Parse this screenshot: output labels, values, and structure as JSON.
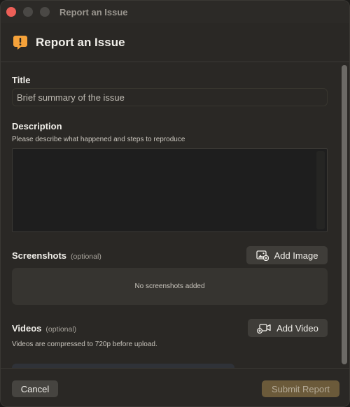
{
  "window": {
    "title": "Report an Issue",
    "traffic_colors": {
      "close": "#ec5f57",
      "minimize": "#4a4845",
      "maximize": "#4a4845"
    }
  },
  "header": {
    "icon": "exclamation-bubble-icon",
    "icon_color": "#f5a23a",
    "title": "Report an Issue"
  },
  "form": {
    "title_label": "Title",
    "title_placeholder": "Brief summary of the issue",
    "title_value": "",
    "description_label": "Description",
    "description_hint": "Please describe what happened and steps to reproduce",
    "description_value": "",
    "screenshots_label": "Screenshots",
    "screenshots_optional": "(optional)",
    "add_image_label": "Add Image",
    "add_image_icon": "photo-add-icon",
    "screenshots_empty": "No screenshots added",
    "videos_label": "Videos",
    "videos_optional": "(optional)",
    "add_video_label": "Add Video",
    "add_video_icon": "video-add-icon",
    "videos_hint": "Videos are compressed to 720p before upload."
  },
  "footer": {
    "cancel_label": "Cancel",
    "submit_label": "Submit Report",
    "submit_color": "#6b5a3a"
  }
}
